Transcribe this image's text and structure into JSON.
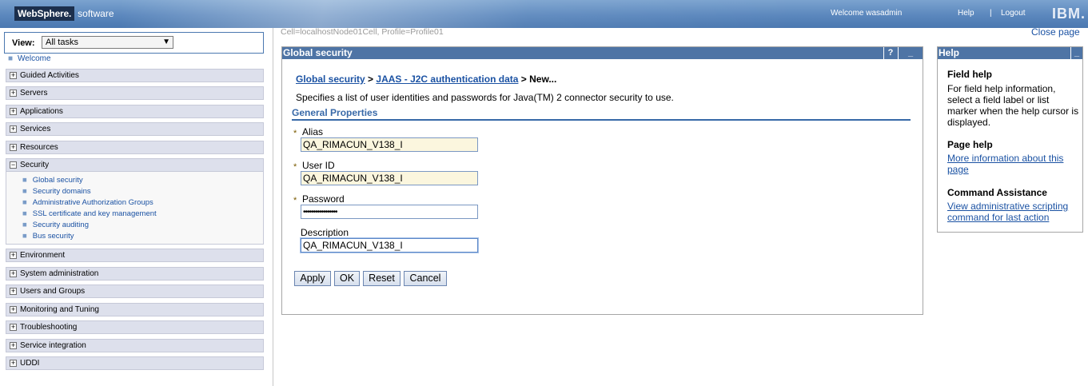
{
  "banner": {
    "brand": "WebSphere.",
    "brand_suffix": "software",
    "welcome": "Welcome wasadmin",
    "help": "Help",
    "separator": "|",
    "logout": "Logout",
    "ibm": "IBM."
  },
  "nav": {
    "view_label": "View:",
    "view_value": "All tasks",
    "welcome": "Welcome",
    "groups": [
      {
        "label": "Guided Activities",
        "state": "+"
      },
      {
        "label": "Servers",
        "state": "+"
      },
      {
        "label": "Applications",
        "state": "+"
      },
      {
        "label": "Services",
        "state": "+"
      },
      {
        "label": "Resources",
        "state": "+"
      },
      {
        "label": "Security",
        "state": "−"
      },
      {
        "label": "Environment",
        "state": "+"
      },
      {
        "label": "System administration",
        "state": "+"
      },
      {
        "label": "Users and Groups",
        "state": "+"
      },
      {
        "label": "Monitoring and Tuning",
        "state": "+"
      },
      {
        "label": "Troubleshooting",
        "state": "+"
      },
      {
        "label": "Service integration",
        "state": "+"
      },
      {
        "label": "UDDI",
        "state": "+"
      }
    ],
    "security_items": [
      "Global security",
      "Security domains",
      "Administrative Authorization Groups",
      "SSL certificate and key management",
      "Security auditing",
      "Bus security"
    ]
  },
  "main": {
    "cell_info": "Cell=localhostNode01Cell, Profile=Profile01",
    "close_page": "Close page",
    "panel_title": "Global security",
    "help_btn": "?",
    "minimize": "_",
    "breadcrumb": {
      "link1": "Global security",
      "sep1": " > ",
      "link2": "JAAS - J2C authentication data",
      "current": " > New..."
    },
    "description": "Specifies a list of user identities and passwords for Java(TM) 2 connector security to use.",
    "section_title": "General Properties",
    "required_mark": "*",
    "fields": {
      "alias_label": "Alias",
      "alias_value": "QA_RIMACUN_V138_I",
      "userid_label": "User ID",
      "userid_value": "QA_RIMACUN_V138_I",
      "password_label": "Password",
      "password_value": "•••••••••••••••••",
      "description_label": "Description",
      "description_value": "QA_RIMACUN_V138_I"
    },
    "buttons": {
      "apply": "Apply",
      "ok": "OK",
      "reset": "Reset",
      "cancel": "Cancel"
    }
  },
  "help": {
    "title": "Help",
    "minimize": "_",
    "field_help_title": "Field help",
    "field_help_text": "For field help information, select a field label or list marker when the help cursor is displayed.",
    "page_help_title": "Page help",
    "page_help_link": "More information about this page",
    "command_title": "Command Assistance",
    "command_link": "View administrative scripting command for last action"
  },
  "colors": {
    "banner": "#5b87bd",
    "panel_header": "#4e74a5",
    "link": "#1b52a3",
    "required_field_bg": "#fbf6de"
  }
}
